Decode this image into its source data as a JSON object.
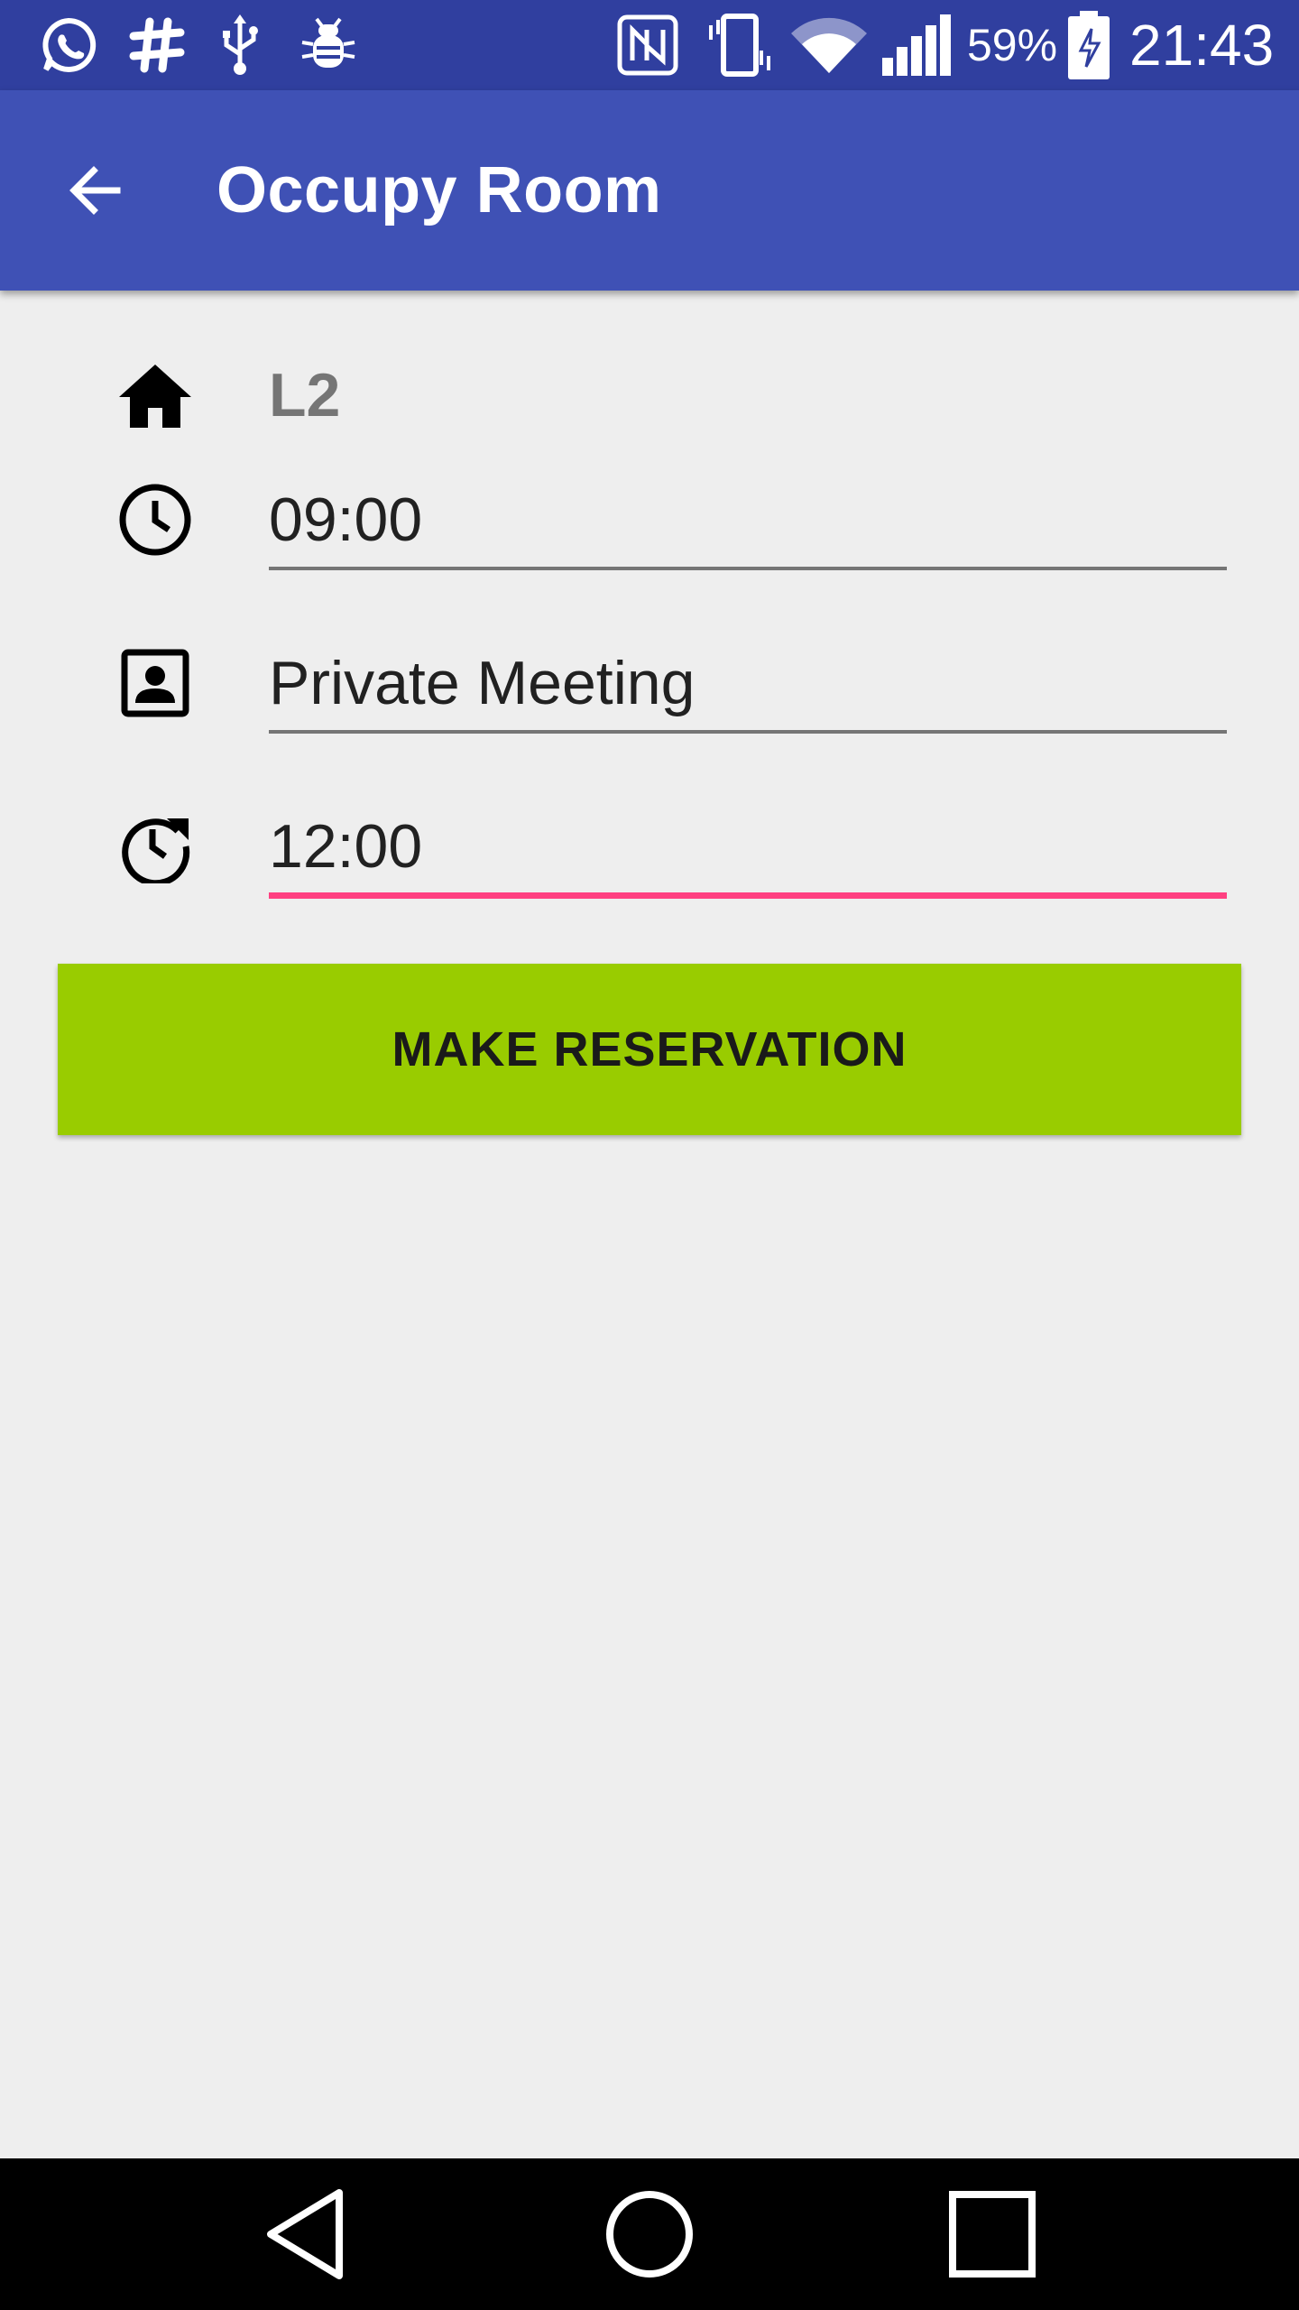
{
  "status_bar": {
    "battery_percent": "59%",
    "time": "21:43",
    "icons": [
      "whatsapp-icon",
      "slack-icon",
      "usb-icon",
      "debug-icon",
      "nfc-icon",
      "vibrate-icon",
      "wifi-icon",
      "signal-icon",
      "battery-charging-icon"
    ]
  },
  "app_bar": {
    "title": "Occupy Room",
    "back_icon": "arrow-back-icon"
  },
  "form": {
    "room": {
      "icon": "home-icon",
      "value": "L2"
    },
    "start_time": {
      "icon": "clock-icon",
      "value": "09:00"
    },
    "purpose": {
      "icon": "contact-card-icon",
      "value": "Private Meeting"
    },
    "end_time": {
      "icon": "clock-restore-icon",
      "value": "12:00"
    }
  },
  "button": {
    "label": "MAKE RESERVATION"
  },
  "nav_bar": {
    "icons": [
      "back-triangle-icon",
      "home-circle-icon",
      "recents-square-icon"
    ]
  },
  "colors": {
    "status_bar": "#303f9f",
    "app_bar": "#3f51b5",
    "background": "#eeeeee",
    "button": "#99cc00",
    "focus_underline": "#ff4081",
    "underline": "#757575"
  }
}
